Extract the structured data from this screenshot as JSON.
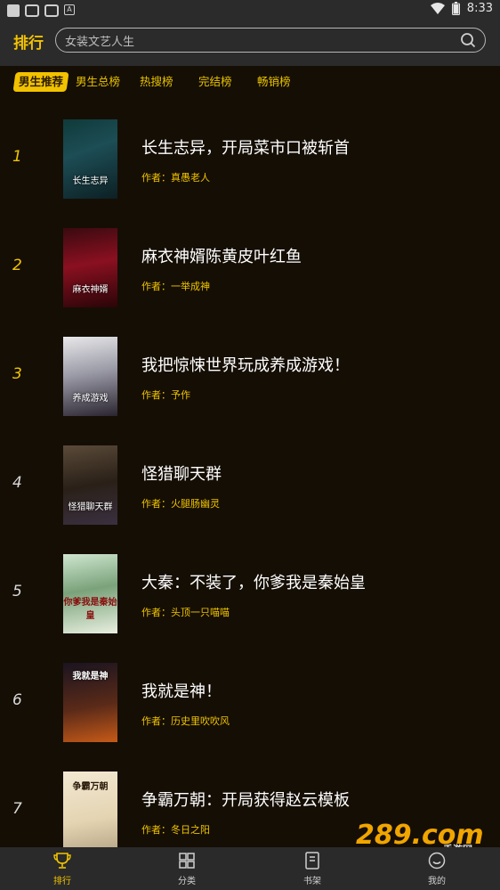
{
  "status": {
    "time": "8:33"
  },
  "header": {
    "title": "排行",
    "search_placeholder": "女装文艺人生"
  },
  "tabs": [
    "男生推荐",
    "男生总榜",
    "热搜榜",
    "完结榜",
    "畅销榜"
  ],
  "author_prefix": "作者：",
  "books": [
    {
      "rank": "1",
      "title": "长生志异，开局菜市口被斩首",
      "author": "作者：真愚老人",
      "cover_text": "长生志异"
    },
    {
      "rank": "2",
      "title": "麻衣神婿陈黄皮叶红鱼",
      "author": "作者：一举成神",
      "cover_text": "麻衣神婿"
    },
    {
      "rank": "3",
      "title": "我把惊悚世界玩成养成游戏！",
      "author": "作者：予作",
      "cover_text": "养成游戏"
    },
    {
      "rank": "4",
      "title": "怪猎聊天群",
      "author": "作者：火腿肠幽灵",
      "cover_text": "怪猎聊天群"
    },
    {
      "rank": "5",
      "title": "大秦：不装了，你爹我是秦始皇",
      "author": "作者：头顶一只喵喵",
      "cover_text": "你爹我是秦始皇"
    },
    {
      "rank": "6",
      "title": "我就是神！",
      "author": "作者：历史里吹吹风",
      "cover_text": "我就是神"
    },
    {
      "rank": "7",
      "title": "争霸万朝：开局获得赵云模板",
      "author": "作者：冬日之阳",
      "cover_text": "争霸万朝"
    }
  ],
  "nav": [
    "排行",
    "分类",
    "书架",
    "我的"
  ],
  "watermark": {
    "text": "289.com",
    "sub": "手游网"
  },
  "colors": {
    "accent": "#f0c400",
    "background": "#150e05",
    "bar": "#2b2b2b"
  }
}
